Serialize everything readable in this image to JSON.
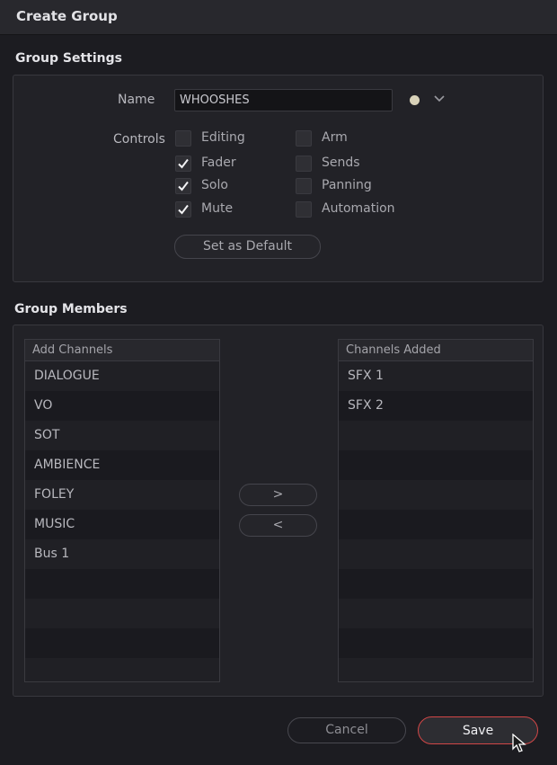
{
  "dialog": {
    "title": "Create Group"
  },
  "group_settings": {
    "section_title": "Group Settings",
    "name_label": "Name",
    "name_value": "WHOOSHES",
    "color_swatch": "#d9d2b9",
    "controls_label": "Controls",
    "controls": [
      {
        "label": "Editing",
        "checked": false
      },
      {
        "label": "Fader",
        "checked": true
      },
      {
        "label": "Solo",
        "checked": true
      },
      {
        "label": "Mute",
        "checked": true
      },
      {
        "label": "Arm",
        "checked": false
      },
      {
        "label": "Sends",
        "checked": false
      },
      {
        "label": "Panning",
        "checked": false
      },
      {
        "label": "Automation",
        "checked": false
      }
    ],
    "set_default_label": "Set as Default"
  },
  "group_members": {
    "section_title": "Group Members",
    "add_channels": {
      "header": "Add Channels",
      "items": [
        "DIALOGUE",
        "VO",
        "SOT",
        "AMBIENCE",
        "FOLEY",
        "MUSIC",
        "Bus 1"
      ]
    },
    "channels_added": {
      "header": "Channels Added",
      "items": [
        "SFX 1",
        "SFX 2"
      ]
    },
    "add_button_label": ">",
    "remove_button_label": "<"
  },
  "footer": {
    "cancel_label": "Cancel",
    "save_label": "Save",
    "save_accent": "#d14747"
  }
}
